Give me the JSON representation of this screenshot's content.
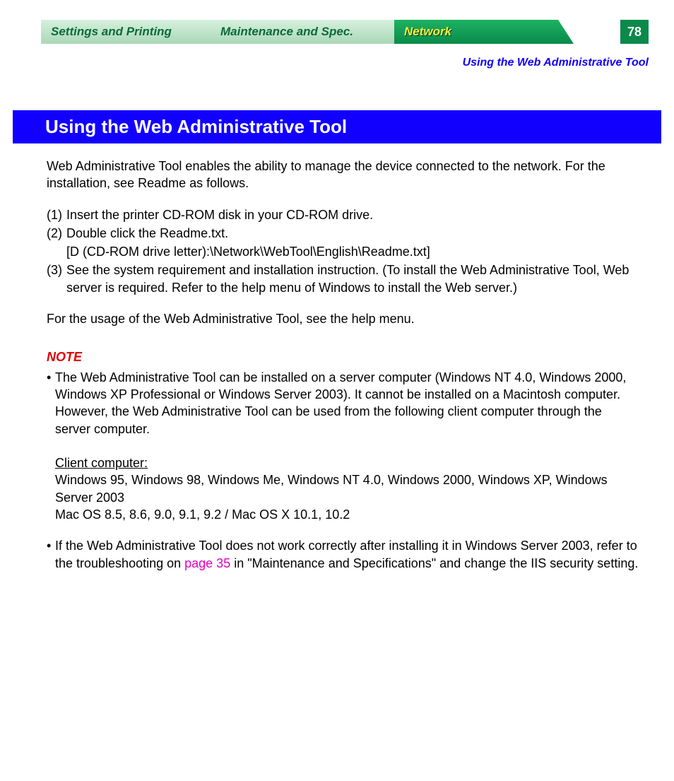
{
  "tabs": {
    "settings": "Settings and Printing",
    "maintenance": "Maintenance and Spec.",
    "network": "Network"
  },
  "page_number": "78",
  "breadcrumb": "Using the Web Administrative Tool",
  "heading": "Using the Web Administrative Tool",
  "intro": "Web Administrative Tool enables the ability to manage the device connected to the network. For the installation, see Readme as follows.",
  "steps": {
    "s1_num": "(1)",
    "s1_txt": "Insert the printer CD-ROM disk in your CD-ROM drive.",
    "s2_num": "(2)",
    "s2_txt": "Double click the Readme.txt.",
    "s2_sub": "[D (CD-ROM drive letter):\\Network\\WebTool\\English\\Readme.txt]",
    "s3_num": "(3)",
    "s3_txt": "See the system requirement and installation instruction. (To install the Web Administrative Tool, Web server is required. Refer to the help menu of Windows to install the Web server.)"
  },
  "usage": "For the usage of the Web Administrative Tool, see the help menu.",
  "note_label": "NOTE",
  "note1": {
    "bullet": "•",
    "a": "The Web Administrative Tool can be installed on a server computer (Windows NT 4.0, Windows 2000, Windows XP Professional or Windows Server 2003). It cannot be installed on a Macintosh computer. However, the Web Administrative Tool can be used from the following client computer through the server computer.",
    "client_label": "Client computer:",
    "client_win": "Windows 95, Windows 98, Windows Me, Windows NT 4.0, Windows 2000, Windows XP, Windows Server 2003",
    "client_mac": "Mac OS 8.5, 8.6, 9.0, 9.1, 9.2 / Mac OS X 10.1, 10.2"
  },
  "note2": {
    "bullet": "•",
    "pre": "If the Web Administrative Tool does not work correctly after installing it in Windows Server 2003, refer to the troubleshooting on ",
    "link": "page 35",
    "post": " in \"Maintenance and Specifications\" and change the IIS security setting."
  }
}
